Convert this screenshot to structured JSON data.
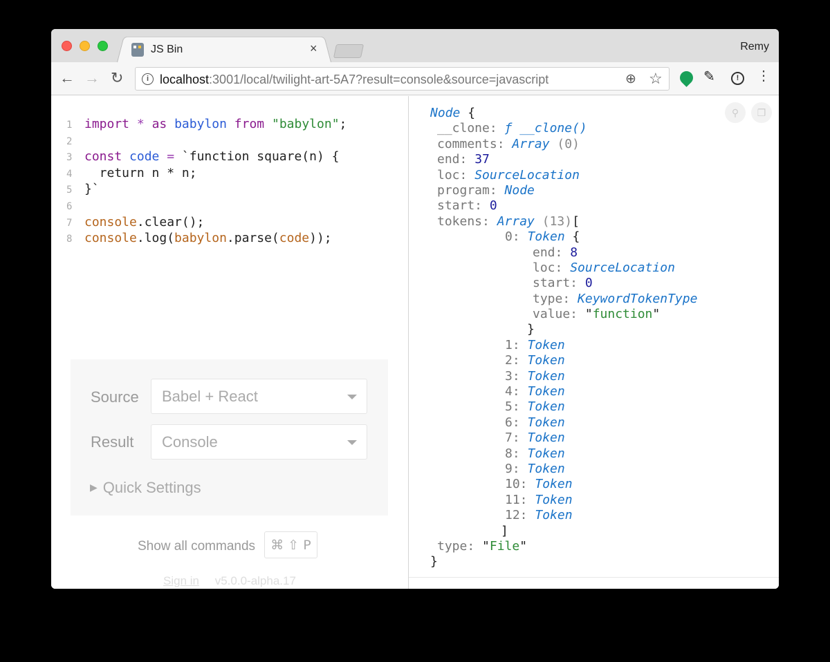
{
  "browser": {
    "tab_title": "JS Bin",
    "tab_close": "×",
    "profile_name": "Remy",
    "url_host": "localhost",
    "url_path": ":3001/local/twilight-art-5A7?result=console&source=javascript",
    "icons": {
      "back": "arrow-left-icon",
      "forward": "arrow-right-icon",
      "reload": "reload-icon",
      "info": "info-icon",
      "zoom": "zoom-icon",
      "star": "star-icon",
      "menu": "more-vertical-icon"
    }
  },
  "editor": {
    "lines": [
      {
        "n": "1",
        "parts": [
          [
            "kw",
            "import"
          ],
          [
            "plain",
            " "
          ],
          [
            "op",
            "*"
          ],
          [
            "plain",
            " "
          ],
          [
            "kw",
            "as"
          ],
          [
            "plain",
            " "
          ],
          [
            "def",
            "babylon"
          ],
          [
            "plain",
            " "
          ],
          [
            "kw",
            "from"
          ],
          [
            "plain",
            " "
          ],
          [
            "str",
            "\"babylon\""
          ],
          [
            "plain",
            ";"
          ]
        ]
      },
      {
        "n": "2",
        "parts": []
      },
      {
        "n": "3",
        "parts": [
          [
            "kw",
            "const"
          ],
          [
            "plain",
            " "
          ],
          [
            "def",
            "code"
          ],
          [
            "plain",
            " "
          ],
          [
            "op",
            "="
          ],
          [
            "plain",
            " `function square(n) {"
          ]
        ]
      },
      {
        "n": "4",
        "parts": [
          [
            "plain",
            "  return n * n;"
          ]
        ]
      },
      {
        "n": "5",
        "parts": [
          [
            "plain",
            "}`"
          ]
        ]
      },
      {
        "n": "6",
        "parts": []
      },
      {
        "n": "7",
        "parts": [
          [
            "prop",
            "console"
          ],
          [
            "plain",
            ".clear();"
          ]
        ]
      },
      {
        "n": "8",
        "parts": [
          [
            "prop",
            "console"
          ],
          [
            "plain",
            ".log("
          ],
          [
            "prop",
            "babylon"
          ],
          [
            "plain",
            ".parse("
          ],
          [
            "prop",
            "code"
          ],
          [
            "plain",
            "));"
          ]
        ]
      }
    ]
  },
  "settings": {
    "source_label": "Source",
    "source_value": "Babel + React",
    "result_label": "Result",
    "result_value": "Console",
    "quick_settings": "Quick Settings",
    "show_commands": "Show all commands",
    "shortcut": "⌘ ⇧ P",
    "sign_in": "Sign in",
    "version": "v5.0.0-alpha.17"
  },
  "console": {
    "lines": [
      {
        "cls": "",
        "parts": [
          [
            "c-type",
            "Node"
          ],
          [
            "c-punc",
            " {"
          ]
        ]
      },
      {
        "cls": "i1",
        "parts": [
          [
            "c-key",
            "__clone: "
          ],
          [
            "c-type",
            "ƒ __clone()"
          ]
        ]
      },
      {
        "cls": "i1",
        "parts": [
          [
            "c-key",
            "comments: "
          ],
          [
            "c-type",
            "Array"
          ],
          [
            "c-meta",
            " (0)"
          ]
        ]
      },
      {
        "cls": "i1",
        "parts": [
          [
            "c-key",
            "end: "
          ],
          [
            "c-num",
            "37"
          ]
        ]
      },
      {
        "cls": "i1",
        "parts": [
          [
            "c-key",
            "loc: "
          ],
          [
            "c-type",
            "SourceLocation"
          ]
        ]
      },
      {
        "cls": "i1",
        "parts": [
          [
            "c-key",
            "program: "
          ],
          [
            "c-type",
            "Node"
          ]
        ]
      },
      {
        "cls": "i1",
        "parts": [
          [
            "c-key",
            "start: "
          ],
          [
            "c-num",
            "0"
          ]
        ]
      },
      {
        "cls": "i1",
        "parts": [
          [
            "c-key",
            "tokens: "
          ],
          [
            "c-type",
            "Array"
          ],
          [
            "c-meta",
            " (13)"
          ],
          [
            "c-punc",
            "["
          ]
        ]
      },
      {
        "cls": "i2",
        "parts": [
          [
            "c-key",
            "0: "
          ],
          [
            "c-type",
            "Token"
          ],
          [
            "c-punc",
            " {"
          ]
        ]
      },
      {
        "cls": "i3",
        "parts": [
          [
            "c-key",
            "end: "
          ],
          [
            "c-num",
            "8"
          ]
        ]
      },
      {
        "cls": "i3",
        "parts": [
          [
            "c-key",
            "loc: "
          ],
          [
            "c-type",
            "SourceLocation"
          ]
        ]
      },
      {
        "cls": "i3",
        "parts": [
          [
            "c-key",
            "start: "
          ],
          [
            "c-num",
            "0"
          ]
        ]
      },
      {
        "cls": "i3",
        "parts": [
          [
            "c-key",
            "type: "
          ],
          [
            "c-type",
            "KeywordTokenType"
          ]
        ]
      },
      {
        "cls": "i3",
        "parts": [
          [
            "c-key",
            "value: "
          ],
          [
            "c-punc",
            "\""
          ],
          [
            "c-str",
            "function"
          ],
          [
            "c-punc",
            "\""
          ]
        ]
      },
      {
        "cls": "i3b",
        "parts": [
          [
            "c-punc",
            "}"
          ]
        ]
      },
      {
        "cls": "i2",
        "parts": [
          [
            "c-key",
            "1: "
          ],
          [
            "c-type",
            "Token"
          ]
        ]
      },
      {
        "cls": "i2",
        "parts": [
          [
            "c-key",
            "2: "
          ],
          [
            "c-type",
            "Token"
          ]
        ]
      },
      {
        "cls": "i2",
        "parts": [
          [
            "c-key",
            "3: "
          ],
          [
            "c-type",
            "Token"
          ]
        ]
      },
      {
        "cls": "i2",
        "parts": [
          [
            "c-key",
            "4: "
          ],
          [
            "c-type",
            "Token"
          ]
        ]
      },
      {
        "cls": "i2",
        "parts": [
          [
            "c-key",
            "5: "
          ],
          [
            "c-type",
            "Token"
          ]
        ]
      },
      {
        "cls": "i2",
        "parts": [
          [
            "c-key",
            "6: "
          ],
          [
            "c-type",
            "Token"
          ]
        ]
      },
      {
        "cls": "i2",
        "parts": [
          [
            "c-key",
            "7: "
          ],
          [
            "c-type",
            "Token"
          ]
        ]
      },
      {
        "cls": "i2",
        "parts": [
          [
            "c-key",
            "8: "
          ],
          [
            "c-type",
            "Token"
          ]
        ]
      },
      {
        "cls": "i2",
        "parts": [
          [
            "c-key",
            "9: "
          ],
          [
            "c-type",
            "Token"
          ]
        ]
      },
      {
        "cls": "i2",
        "parts": [
          [
            "c-key",
            "10: "
          ],
          [
            "c-type",
            "Token"
          ]
        ]
      },
      {
        "cls": "i2",
        "parts": [
          [
            "c-key",
            "11: "
          ],
          [
            "c-type",
            "Token"
          ]
        ]
      },
      {
        "cls": "i2",
        "parts": [
          [
            "c-key",
            "12: "
          ],
          [
            "c-type",
            "Token"
          ]
        ]
      },
      {
        "cls": "i1b",
        "parts": [
          [
            "c-punc",
            "]"
          ]
        ]
      },
      {
        "cls": "i1",
        "parts": [
          [
            "c-key",
            "type: "
          ],
          [
            "c-punc",
            "\""
          ],
          [
            "c-str",
            "File"
          ],
          [
            "c-punc",
            "\""
          ]
        ]
      },
      {
        "cls": "",
        "parts": [
          [
            "c-punc",
            "}"
          ]
        ]
      }
    ]
  }
}
